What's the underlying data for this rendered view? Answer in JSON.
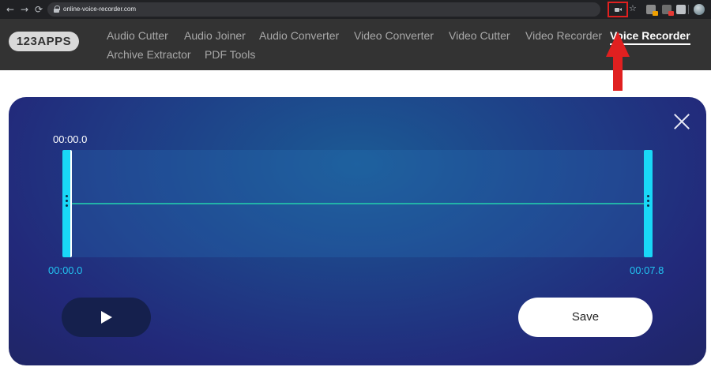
{
  "browser": {
    "back_icon": "←",
    "forward_icon": "→",
    "reload_icon": "⟳",
    "url": "online-voice-recorder.com",
    "star_icon": "☆"
  },
  "site": {
    "logo": "123APPS",
    "nav": [
      {
        "label": "Audio Cutter"
      },
      {
        "label": "Audio Joiner"
      },
      {
        "label": "Audio Converter"
      },
      {
        "label": "Video Converter"
      },
      {
        "label": "Video Cutter"
      },
      {
        "label": "Video Recorder"
      },
      {
        "label": "Voice Recorder",
        "active": true
      },
      {
        "label": "Archive Extractor"
      },
      {
        "label": "PDF Tools"
      }
    ]
  },
  "recorder": {
    "current_time": "00:00.0",
    "start_time": "00:00.0",
    "end_time": "00:07.8",
    "save_label": "Save"
  },
  "colors": {
    "handle": "#19d8f7",
    "waveform": "#22b3a8",
    "timestamp": "#22c3f0",
    "annotation": "#e02020"
  }
}
